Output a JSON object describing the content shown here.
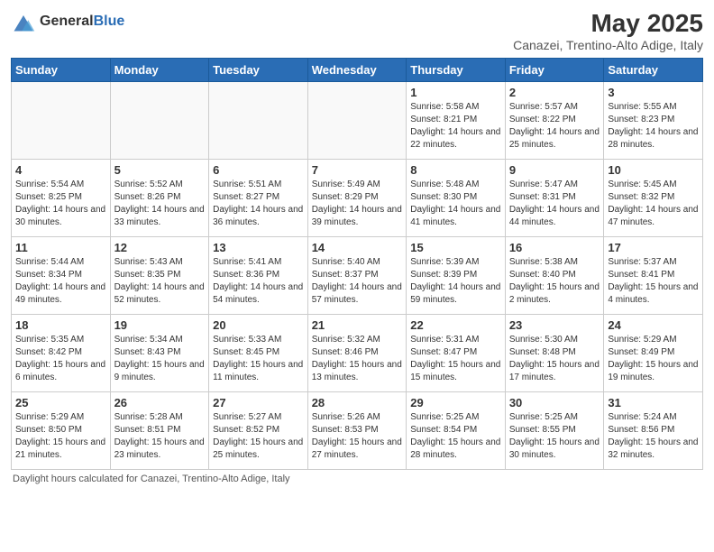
{
  "header": {
    "logo_general": "General",
    "logo_blue": "Blue",
    "title": "May 2025",
    "subtitle": "Canazei, Trentino-Alto Adige, Italy"
  },
  "days": [
    "Sunday",
    "Monday",
    "Tuesday",
    "Wednesday",
    "Thursday",
    "Friday",
    "Saturday"
  ],
  "weeks": [
    [
      {
        "num": "",
        "sunrise": "",
        "sunset": "",
        "daylight": ""
      },
      {
        "num": "",
        "sunrise": "",
        "sunset": "",
        "daylight": ""
      },
      {
        "num": "",
        "sunrise": "",
        "sunset": "",
        "daylight": ""
      },
      {
        "num": "",
        "sunrise": "",
        "sunset": "",
        "daylight": ""
      },
      {
        "num": "1",
        "sunrise": "Sunrise: 5:58 AM",
        "sunset": "Sunset: 8:21 PM",
        "daylight": "Daylight: 14 hours and 22 minutes."
      },
      {
        "num": "2",
        "sunrise": "Sunrise: 5:57 AM",
        "sunset": "Sunset: 8:22 PM",
        "daylight": "Daylight: 14 hours and 25 minutes."
      },
      {
        "num": "3",
        "sunrise": "Sunrise: 5:55 AM",
        "sunset": "Sunset: 8:23 PM",
        "daylight": "Daylight: 14 hours and 28 minutes."
      }
    ],
    [
      {
        "num": "4",
        "sunrise": "Sunrise: 5:54 AM",
        "sunset": "Sunset: 8:25 PM",
        "daylight": "Daylight: 14 hours and 30 minutes."
      },
      {
        "num": "5",
        "sunrise": "Sunrise: 5:52 AM",
        "sunset": "Sunset: 8:26 PM",
        "daylight": "Daylight: 14 hours and 33 minutes."
      },
      {
        "num": "6",
        "sunrise": "Sunrise: 5:51 AM",
        "sunset": "Sunset: 8:27 PM",
        "daylight": "Daylight: 14 hours and 36 minutes."
      },
      {
        "num": "7",
        "sunrise": "Sunrise: 5:49 AM",
        "sunset": "Sunset: 8:29 PM",
        "daylight": "Daylight: 14 hours and 39 minutes."
      },
      {
        "num": "8",
        "sunrise": "Sunrise: 5:48 AM",
        "sunset": "Sunset: 8:30 PM",
        "daylight": "Daylight: 14 hours and 41 minutes."
      },
      {
        "num": "9",
        "sunrise": "Sunrise: 5:47 AM",
        "sunset": "Sunset: 8:31 PM",
        "daylight": "Daylight: 14 hours and 44 minutes."
      },
      {
        "num": "10",
        "sunrise": "Sunrise: 5:45 AM",
        "sunset": "Sunset: 8:32 PM",
        "daylight": "Daylight: 14 hours and 47 minutes."
      }
    ],
    [
      {
        "num": "11",
        "sunrise": "Sunrise: 5:44 AM",
        "sunset": "Sunset: 8:34 PM",
        "daylight": "Daylight: 14 hours and 49 minutes."
      },
      {
        "num": "12",
        "sunrise": "Sunrise: 5:43 AM",
        "sunset": "Sunset: 8:35 PM",
        "daylight": "Daylight: 14 hours and 52 minutes."
      },
      {
        "num": "13",
        "sunrise": "Sunrise: 5:41 AM",
        "sunset": "Sunset: 8:36 PM",
        "daylight": "Daylight: 14 hours and 54 minutes."
      },
      {
        "num": "14",
        "sunrise": "Sunrise: 5:40 AM",
        "sunset": "Sunset: 8:37 PM",
        "daylight": "Daylight: 14 hours and 57 minutes."
      },
      {
        "num": "15",
        "sunrise": "Sunrise: 5:39 AM",
        "sunset": "Sunset: 8:39 PM",
        "daylight": "Daylight: 14 hours and 59 minutes."
      },
      {
        "num": "16",
        "sunrise": "Sunrise: 5:38 AM",
        "sunset": "Sunset: 8:40 PM",
        "daylight": "Daylight: 15 hours and 2 minutes."
      },
      {
        "num": "17",
        "sunrise": "Sunrise: 5:37 AM",
        "sunset": "Sunset: 8:41 PM",
        "daylight": "Daylight: 15 hours and 4 minutes."
      }
    ],
    [
      {
        "num": "18",
        "sunrise": "Sunrise: 5:35 AM",
        "sunset": "Sunset: 8:42 PM",
        "daylight": "Daylight: 15 hours and 6 minutes."
      },
      {
        "num": "19",
        "sunrise": "Sunrise: 5:34 AM",
        "sunset": "Sunset: 8:43 PM",
        "daylight": "Daylight: 15 hours and 9 minutes."
      },
      {
        "num": "20",
        "sunrise": "Sunrise: 5:33 AM",
        "sunset": "Sunset: 8:45 PM",
        "daylight": "Daylight: 15 hours and 11 minutes."
      },
      {
        "num": "21",
        "sunrise": "Sunrise: 5:32 AM",
        "sunset": "Sunset: 8:46 PM",
        "daylight": "Daylight: 15 hours and 13 minutes."
      },
      {
        "num": "22",
        "sunrise": "Sunrise: 5:31 AM",
        "sunset": "Sunset: 8:47 PM",
        "daylight": "Daylight: 15 hours and 15 minutes."
      },
      {
        "num": "23",
        "sunrise": "Sunrise: 5:30 AM",
        "sunset": "Sunset: 8:48 PM",
        "daylight": "Daylight: 15 hours and 17 minutes."
      },
      {
        "num": "24",
        "sunrise": "Sunrise: 5:29 AM",
        "sunset": "Sunset: 8:49 PM",
        "daylight": "Daylight: 15 hours and 19 minutes."
      }
    ],
    [
      {
        "num": "25",
        "sunrise": "Sunrise: 5:29 AM",
        "sunset": "Sunset: 8:50 PM",
        "daylight": "Daylight: 15 hours and 21 minutes."
      },
      {
        "num": "26",
        "sunrise": "Sunrise: 5:28 AM",
        "sunset": "Sunset: 8:51 PM",
        "daylight": "Daylight: 15 hours and 23 minutes."
      },
      {
        "num": "27",
        "sunrise": "Sunrise: 5:27 AM",
        "sunset": "Sunset: 8:52 PM",
        "daylight": "Daylight: 15 hours and 25 minutes."
      },
      {
        "num": "28",
        "sunrise": "Sunrise: 5:26 AM",
        "sunset": "Sunset: 8:53 PM",
        "daylight": "Daylight: 15 hours and 27 minutes."
      },
      {
        "num": "29",
        "sunrise": "Sunrise: 5:25 AM",
        "sunset": "Sunset: 8:54 PM",
        "daylight": "Daylight: 15 hours and 28 minutes."
      },
      {
        "num": "30",
        "sunrise": "Sunrise: 5:25 AM",
        "sunset": "Sunset: 8:55 PM",
        "daylight": "Daylight: 15 hours and 30 minutes."
      },
      {
        "num": "31",
        "sunrise": "Sunrise: 5:24 AM",
        "sunset": "Sunset: 8:56 PM",
        "daylight": "Daylight: 15 hours and 32 minutes."
      }
    ]
  ],
  "footer": "Daylight hours calculated for Canazei, Trentino-Alto Adige, Italy"
}
